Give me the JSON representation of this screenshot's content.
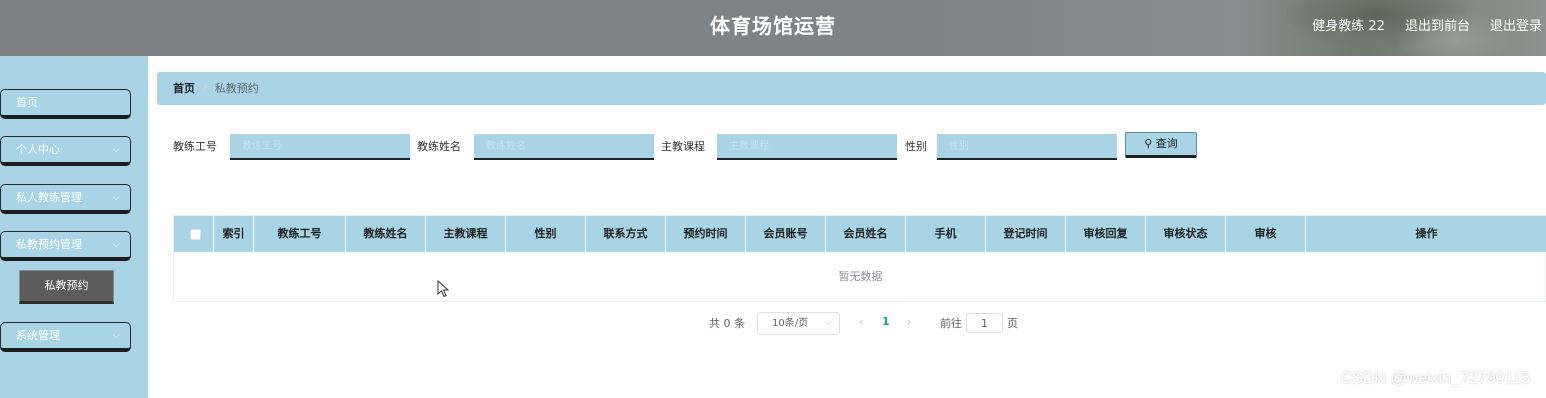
{
  "header": {
    "title": "体育场馆运营",
    "user": "健身教练 22",
    "front_link": "退出到前台",
    "logout_link": "退出登录"
  },
  "sidebar": {
    "items": [
      {
        "label": "首页"
      },
      {
        "label": "个人中心",
        "chevron": "⌵"
      },
      {
        "label": "私人教练管理",
        "chevron": "⌵"
      },
      {
        "label": "私教预约管理",
        "chevron": "⌵"
      },
      {
        "label": "系统管理",
        "chevron": "⌵"
      }
    ],
    "submenu_active": "私教预约"
  },
  "breadcrumb": {
    "home": "首页",
    "separator": "/",
    "current": "私教预约"
  },
  "filters": {
    "coach_id_label": "教练工号",
    "coach_id_placeholder": "教练工号",
    "coach_name_label": "教练姓名",
    "coach_name_placeholder": "教练姓名",
    "course_label": "主教课程",
    "course_placeholder": "主教课程",
    "gender_label": "性别",
    "gender_placeholder": "性别",
    "search_button": "查询",
    "search_icon": "⚲"
  },
  "table": {
    "columns": [
      "索引",
      "教练工号",
      "教练姓名",
      "主教课程",
      "性别",
      "联系方式",
      "预约时间",
      "会员账号",
      "会员姓名",
      "手机",
      "登记时间",
      "审核回复",
      "审核状态",
      "审核",
      "操作"
    ],
    "empty_text": "暂无数据"
  },
  "pagination": {
    "total": "共 0 条",
    "page_size": "10条/页",
    "caret": "⌵",
    "prev": "‹",
    "current_page": "1",
    "next": "›",
    "goto_label": "前往",
    "goto_value": "1",
    "page_suffix": "页"
  },
  "watermark": "CSDN @weixin_72790115",
  "colors": {
    "header_bg": "#808387",
    "sidebar_bg": "#a8d4e6",
    "accent": "#a8d4e6",
    "active_submenu": "#5b5b5b",
    "page_active": "#1aa094"
  }
}
